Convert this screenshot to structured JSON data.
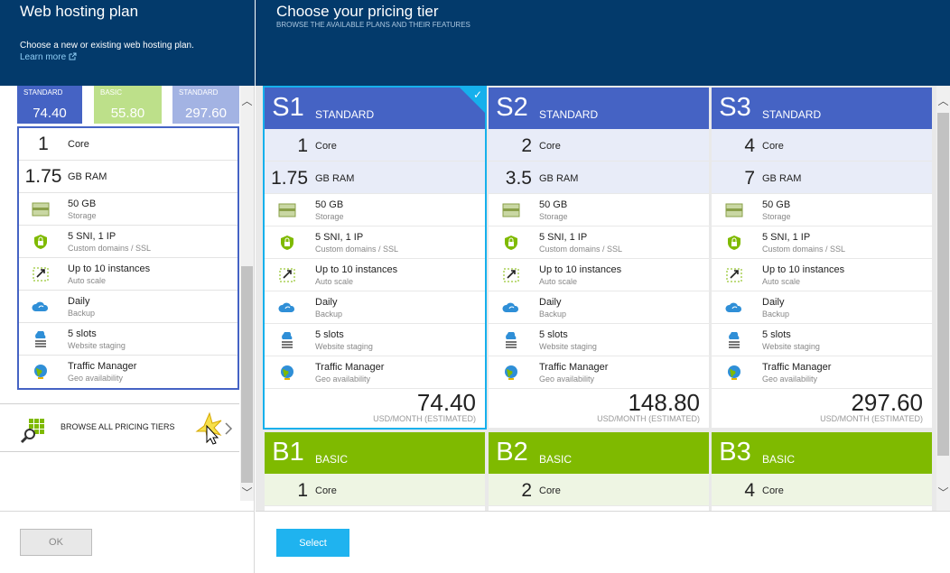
{
  "left": {
    "title": "Web hosting plan",
    "description": "Choose a new or existing web hosting plan.",
    "learn_more": "Learn more",
    "tabs": [
      {
        "tier": "STANDARD",
        "price": "74.40",
        "color": "#4563c4"
      },
      {
        "tier": "BASIC",
        "price": "55.80",
        "color": "#bde08a"
      },
      {
        "tier": "STANDARD",
        "price": "297.60",
        "color": "#a3b3e3"
      }
    ],
    "core_num": "1",
    "core_label": "Core",
    "ram_num": "1.75",
    "ram_label": "GB RAM",
    "features": [
      {
        "main": "50 GB",
        "sub": "Storage",
        "icon": "storage-icon"
      },
      {
        "main": "5 SNI, 1 IP",
        "sub": "Custom domains / SSL",
        "icon": "ssl-shield-icon"
      },
      {
        "main": "Up to 10 instances",
        "sub": "Auto scale",
        "icon": "autoscale-icon"
      },
      {
        "main": "Daily",
        "sub": "Backup",
        "icon": "backup-cloud-icon"
      },
      {
        "main": "5 slots",
        "sub": "Website staging",
        "icon": "staging-icon"
      },
      {
        "main": "Traffic Manager",
        "sub": "Geo availability",
        "icon": "globe-icon"
      }
    ],
    "browse_label": "BROWSE ALL PRICING TIERS",
    "ok_label": "OK"
  },
  "right": {
    "title": "Choose your pricing tier",
    "subtitle": "BROWSE THE AVAILABLE PLANS AND THEIR FEATURES",
    "select_label": "Select",
    "price_note": "USD/MONTH (ESTIMATED)",
    "cards": [
      {
        "code": "S1",
        "tier": "STANDARD",
        "cores": "1",
        "core_label": "Core",
        "ram": "1.75",
        "ram_label": "GB RAM",
        "price": "74.40",
        "color": "#4563c4",
        "selected": true
      },
      {
        "code": "S2",
        "tier": "STANDARD",
        "cores": "2",
        "core_label": "Core",
        "ram": "3.5",
        "ram_label": "GB RAM",
        "price": "148.80",
        "color": "#4563c4",
        "selected": false
      },
      {
        "code": "S3",
        "tier": "STANDARD",
        "cores": "4",
        "core_label": "Core",
        "ram": "7",
        "ram_label": "GB RAM",
        "price": "297.60",
        "color": "#4563c4",
        "selected": false
      }
    ],
    "basic_cards": [
      {
        "code": "B1",
        "tier": "BASIC",
        "cores": "1",
        "core_label": "Core",
        "color": "#7fba00"
      },
      {
        "code": "B2",
        "tier": "BASIC",
        "cores": "2",
        "core_label": "Core",
        "color": "#7fba00"
      },
      {
        "code": "B3",
        "tier": "BASIC",
        "cores": "4",
        "core_label": "Core",
        "color": "#7fba00"
      }
    ]
  }
}
